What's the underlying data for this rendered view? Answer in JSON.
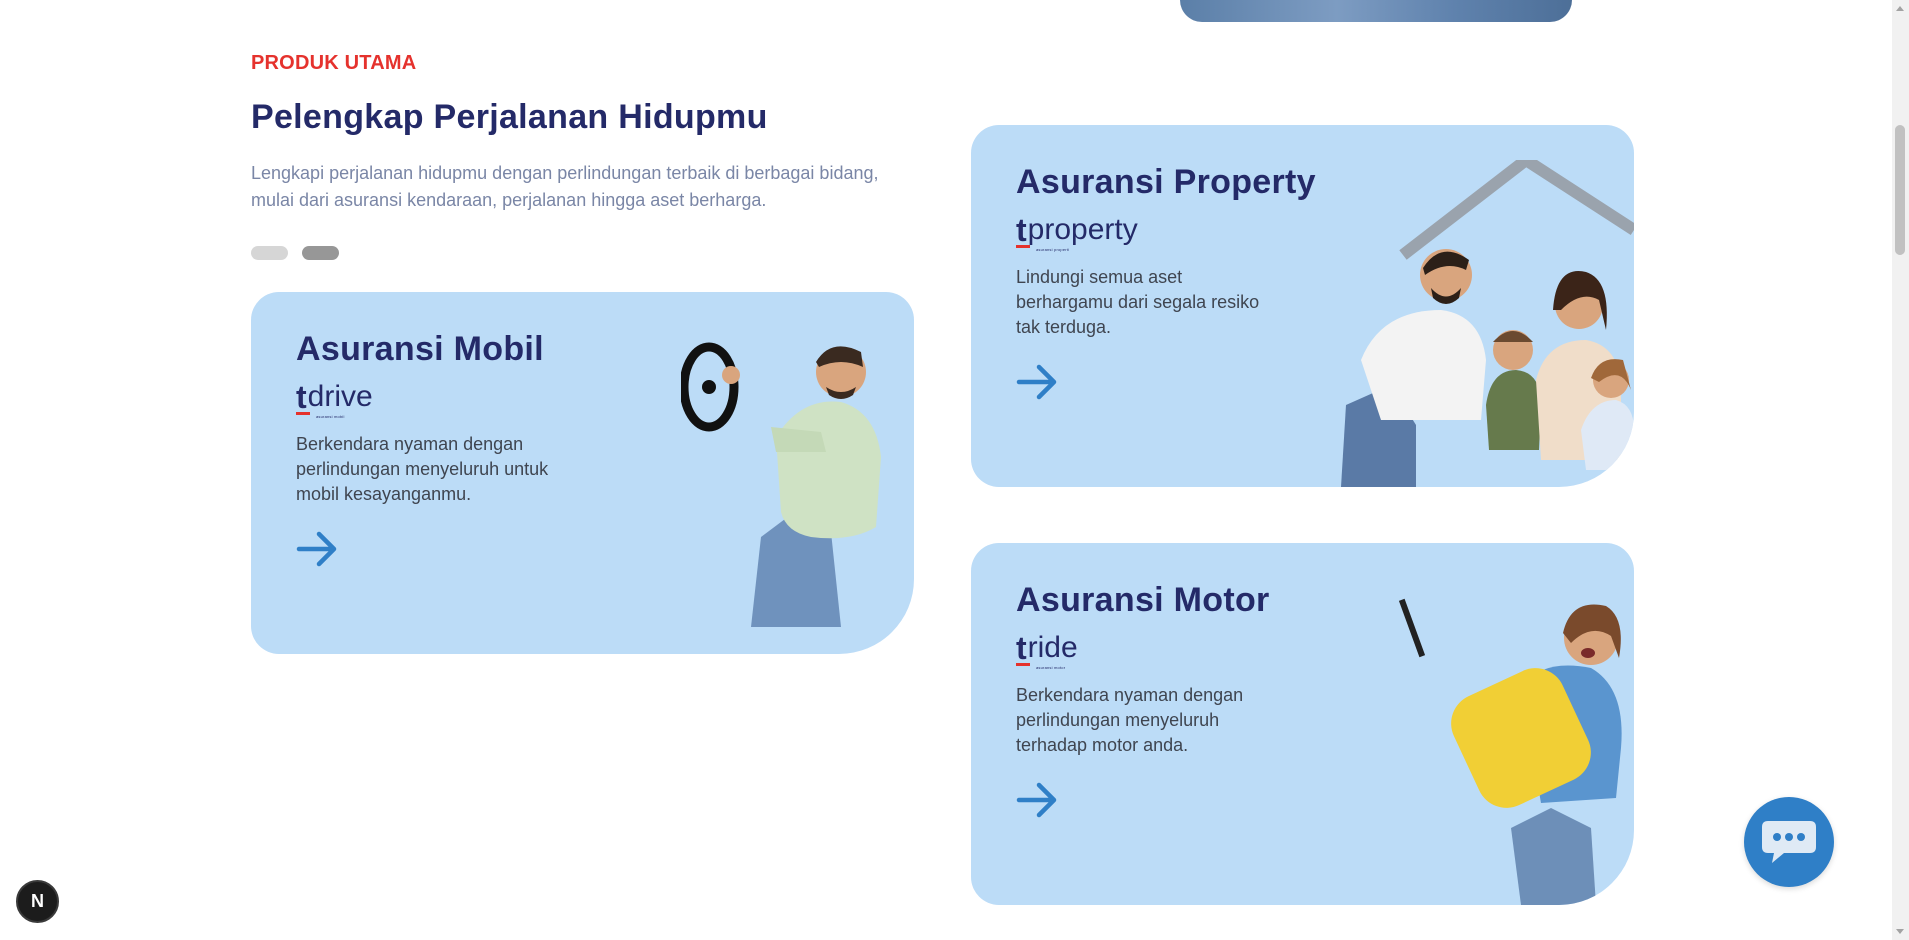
{
  "section": {
    "eyebrow": "PRODUK UTAMA",
    "title": "Pelengkap Perjalanan Hidupmu",
    "description": "Lengkapi perjalanan hidupmu dengan perlindungan terbaik di berbagai bidang, mulai dari asuransi kendaraan, perjalanan hingga aset berharga.",
    "carousel": {
      "total_pages": 2,
      "active_page": 2
    }
  },
  "products": {
    "mobil": {
      "title": "Asuransi Mobil",
      "brand_t": "t",
      "brand_word": "drive",
      "brand_sub": "asuransi mobil",
      "description": "Berkendara nyaman dengan perlindungan menyeluruh untuk mobil kesayanganmu.",
      "arrow_icon": "arrow-right-icon"
    },
    "property": {
      "title": "Asuransi Property",
      "brand_t": "t",
      "brand_word": "property",
      "brand_sub": "asuransi properti",
      "description": "Lindungi semua aset berhargamu dari segala resiko tak terduga.",
      "arrow_icon": "arrow-right-icon"
    },
    "motor": {
      "title": "Asuransi Motor",
      "brand_t": "t",
      "brand_word": "ride",
      "brand_sub": "asuransi motor",
      "description": "Berkendara nyaman dengan perlindungan menyeluruh terhadap motor anda.",
      "arrow_icon": "arrow-right-icon"
    }
  },
  "chat_button": {
    "icon": "chat-bubble-icon"
  },
  "dev_badge": {
    "label": "N"
  },
  "colors": {
    "accent_red": "#e5322d",
    "navy": "#242a68",
    "card_bg": "#bcdcf7",
    "arrow_blue": "#2f7fc7"
  }
}
